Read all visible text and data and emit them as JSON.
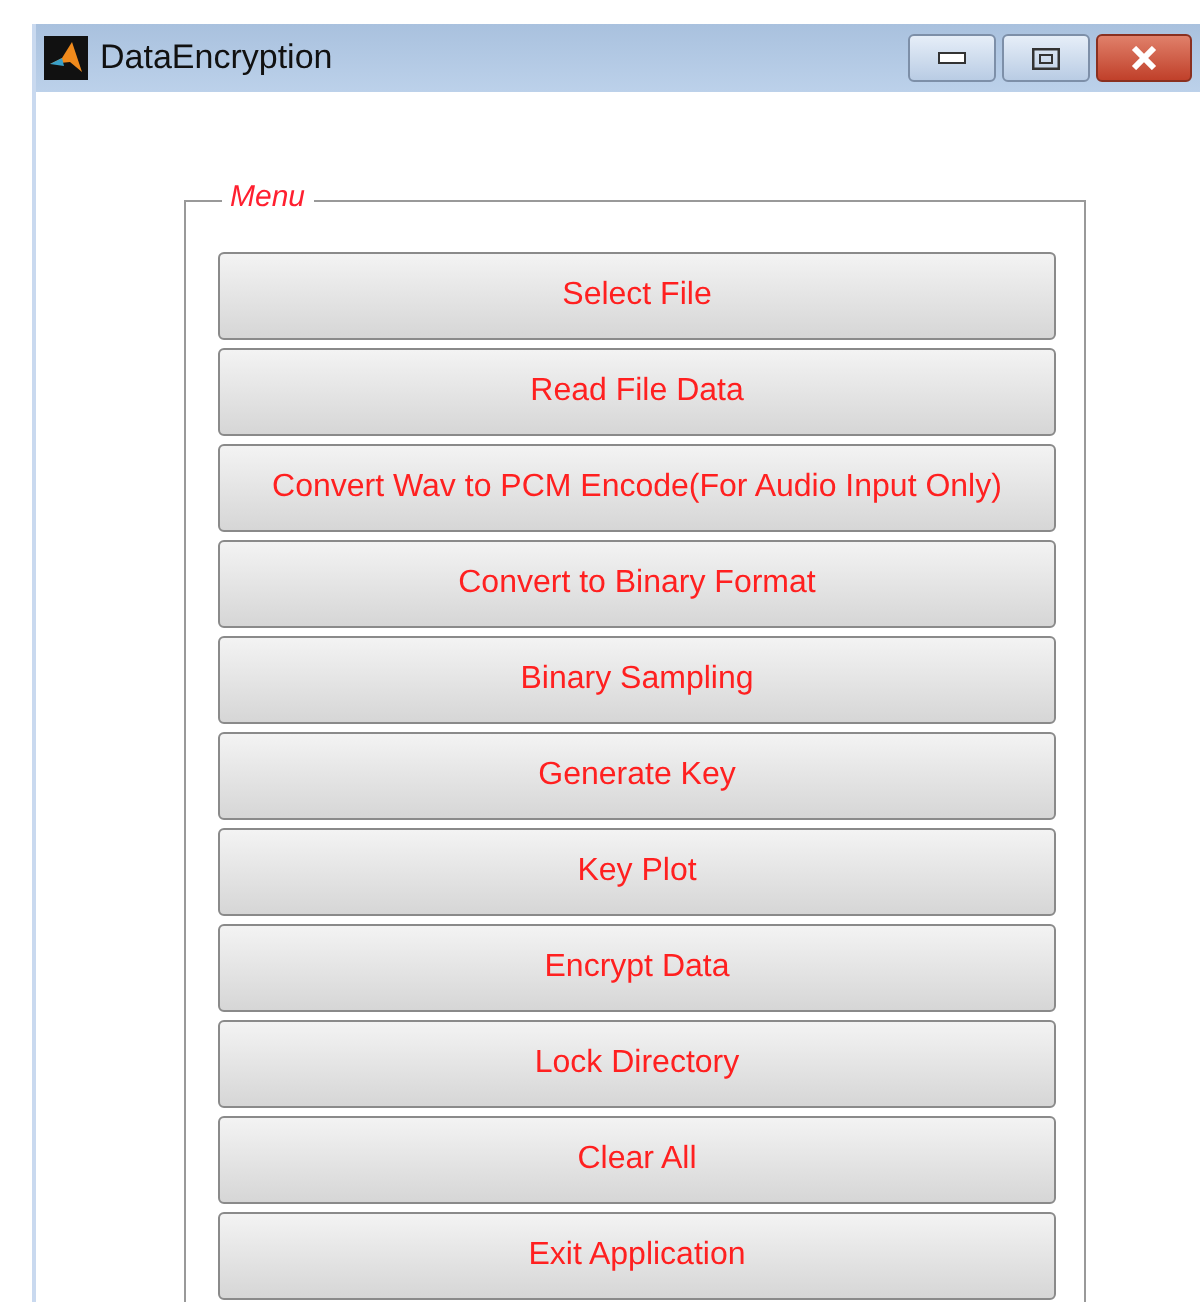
{
  "window": {
    "title": "DataEncryption"
  },
  "menu": {
    "title": "Menu",
    "buttons": [
      "Select File",
      "Read File Data",
      "Convert Wav to PCM Encode(For Audio Input Only)",
      "Convert to Binary Format",
      "Binary Sampling",
      "Generate Key",
      "Key Plot",
      "Encrypt Data",
      "Lock Directory",
      "Clear All",
      "Exit Application"
    ]
  }
}
